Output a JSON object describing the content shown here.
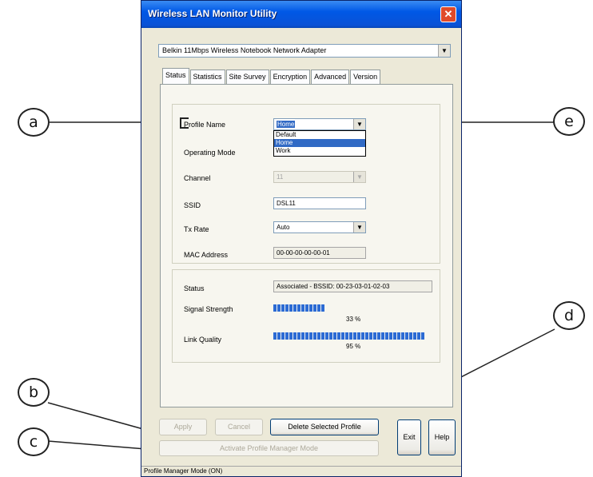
{
  "window": {
    "title": "Wireless LAN Monitor Utility",
    "close_label": "✕"
  },
  "adapter": {
    "selected": "Belkin 11Mbps Wireless Notebook Network Adapter"
  },
  "tabs": [
    {
      "label": "Status",
      "active": true
    },
    {
      "label": "Statistics"
    },
    {
      "label": "Site Survey"
    },
    {
      "label": "Encryption"
    },
    {
      "label": "Advanced"
    },
    {
      "label": "Version"
    }
  ],
  "profile": {
    "label": "Profile Name",
    "value": "Home",
    "options": [
      "Default",
      "Home",
      "Work"
    ],
    "selected_option": "Home"
  },
  "fields": {
    "operating_mode_label": "Operating Mode",
    "channel_label": "Channel",
    "channel_value": "11",
    "ssid_label": "SSID",
    "ssid_value": "DSL11",
    "tx_rate_label": "Tx Rate",
    "tx_rate_value": "Auto",
    "mac_label": "MAC Address",
    "mac_value": "00-00-00-00-00-01"
  },
  "status": {
    "status_label": "Status",
    "status_value": "Associated - BSSID: 00-23-03-01-02-03",
    "signal_label": "Signal Strength",
    "signal_percent": "33 %",
    "signal_level": 0.33,
    "link_label": "Link Quality",
    "link_percent": "95 %",
    "link_level": 0.95
  },
  "buttons": {
    "apply": "Apply",
    "cancel": "Cancel",
    "delete_profile": "Delete Selected Profile",
    "activate_profile_mode": "Activate Profile Manager Mode",
    "exit": "Exit",
    "help": "Help"
  },
  "statusbar": {
    "text": "Profile Manager Mode (ON)"
  },
  "callouts": {
    "a": "a",
    "b": "b",
    "c": "c",
    "d": "d",
    "e": "e"
  }
}
